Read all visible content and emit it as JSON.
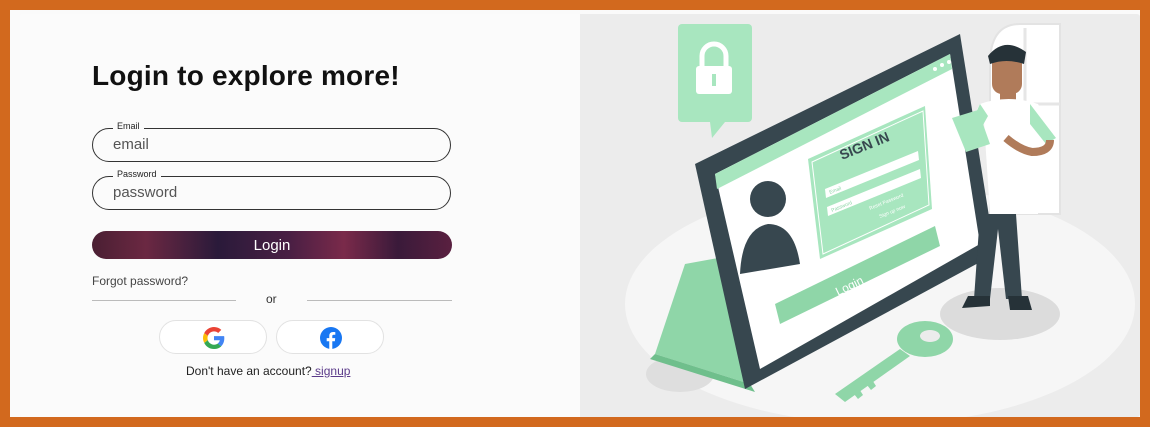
{
  "heading": "Login to explore more!",
  "email": {
    "label": "Email",
    "placeholder": "email"
  },
  "password": {
    "label": "Password",
    "placeholder": "password"
  },
  "login_button": "Login",
  "forgot_password": "Forgot password?",
  "divider_text": "or",
  "social": {
    "google_icon": "google-icon",
    "facebook_icon": "facebook-icon"
  },
  "signup": {
    "prompt": "Don't have an account?",
    "link": " signup"
  },
  "illustration": {
    "sign_in_title": "SIGN IN",
    "email_hint": "Email",
    "password_hint": "Password",
    "reset": "Reset Password",
    "sign_up_now": "Sign up now",
    "login_label": "Login"
  },
  "colors": {
    "border": "#d2691e",
    "accent": "#9be3b0",
    "dark": "#37474f"
  }
}
